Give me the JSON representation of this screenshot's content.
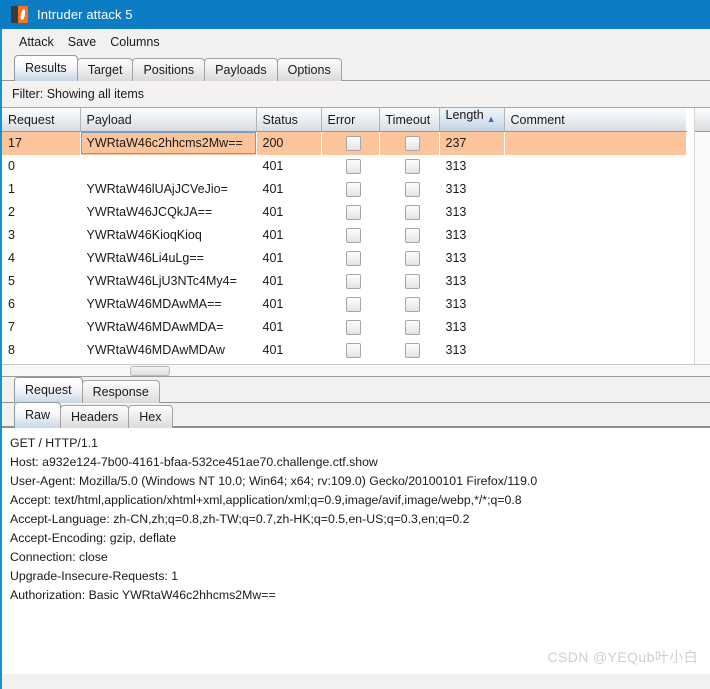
{
  "titlebar": {
    "title": "Intruder attack 5",
    "icon": "burp-suite-icon",
    "bg": "#0c7cc4"
  },
  "menubar": {
    "items": [
      {
        "label": "Attack"
      },
      {
        "label": "Save"
      },
      {
        "label": "Columns"
      }
    ]
  },
  "main_tabs": [
    {
      "label": "Results",
      "active": true
    },
    {
      "label": "Target",
      "active": false
    },
    {
      "label": "Positions",
      "active": false
    },
    {
      "label": "Payloads",
      "active": false
    },
    {
      "label": "Options",
      "active": false
    }
  ],
  "filter": {
    "label": "Filter: Showing all items"
  },
  "results_table": {
    "columns": [
      {
        "label": "Request",
        "sorted": false
      },
      {
        "label": "Payload",
        "sorted": false
      },
      {
        "label": "Status",
        "sorted": false
      },
      {
        "label": "Error",
        "sorted": false
      },
      {
        "label": "Timeout",
        "sorted": false
      },
      {
        "label": "Length",
        "sorted": true,
        "sort_arrow": "▲"
      },
      {
        "label": "Comment",
        "sorted": false
      }
    ],
    "rows": [
      {
        "request": "17",
        "payload": "YWRtaW46c2hhcms2Mw==",
        "status": "200",
        "error": false,
        "timeout": false,
        "length": "237",
        "comment": "",
        "selected": true
      },
      {
        "request": "0",
        "payload": "",
        "status": "401",
        "error": false,
        "timeout": false,
        "length": "313",
        "comment": "",
        "selected": false
      },
      {
        "request": "1",
        "payload": "YWRtaW46lUAjJCVeJio=",
        "status": "401",
        "error": false,
        "timeout": false,
        "length": "313",
        "comment": "",
        "selected": false
      },
      {
        "request": "2",
        "payload": "YWRtaW46JCQkJA==",
        "status": "401",
        "error": false,
        "timeout": false,
        "length": "313",
        "comment": "",
        "selected": false
      },
      {
        "request": "3",
        "payload": "YWRtaW46KioqKioq",
        "status": "401",
        "error": false,
        "timeout": false,
        "length": "313",
        "comment": "",
        "selected": false
      },
      {
        "request": "4",
        "payload": "YWRtaW46Li4uLg==",
        "status": "401",
        "error": false,
        "timeout": false,
        "length": "313",
        "comment": "",
        "selected": false
      },
      {
        "request": "5",
        "payload": "YWRtaW46LjU3NTc4My4=",
        "status": "401",
        "error": false,
        "timeout": false,
        "length": "313",
        "comment": "",
        "selected": false
      },
      {
        "request": "6",
        "payload": "YWRtaW46MDAwMA==",
        "status": "401",
        "error": false,
        "timeout": false,
        "length": "313",
        "comment": "",
        "selected": false
      },
      {
        "request": "7",
        "payload": "YWRtaW46MDAwMDA=",
        "status": "401",
        "error": false,
        "timeout": false,
        "length": "313",
        "comment": "",
        "selected": false
      },
      {
        "request": "8",
        "payload": "YWRtaW46MDAwMDAw",
        "status": "401",
        "error": false,
        "timeout": false,
        "length": "313",
        "comment": "",
        "selected": false
      }
    ],
    "selected_row_color": "#fbc49a"
  },
  "message_tabs": [
    {
      "label": "Request",
      "active": true
    },
    {
      "label": "Response",
      "active": false
    }
  ],
  "view_tabs": [
    {
      "label": "Raw",
      "active": true
    },
    {
      "label": "Headers",
      "active": false
    },
    {
      "label": "Hex",
      "active": false
    }
  ],
  "raw_request": {
    "lines": [
      "GET / HTTP/1.1",
      "Host: a932e124-7b00-4161-bfaa-532ce451ae70.challenge.ctf.show",
      "User-Agent: Mozilla/5.0 (Windows NT 10.0; Win64; x64; rv:109.0) Gecko/20100101 Firefox/119.0",
      "Accept: text/html,application/xhtml+xml,application/xml;q=0.9,image/avif,image/webp,*/*;q=0.8",
      "Accept-Language: zh-CN,zh;q=0.8,zh-TW;q=0.7,zh-HK;q=0.5,en-US;q=0.3,en;q=0.2",
      "Accept-Encoding: gzip, deflate",
      "Connection: close",
      "Upgrade-Insecure-Requests: 1",
      "Authorization: Basic YWRtaW46c2hhcms2Mw=="
    ]
  },
  "watermark": {
    "text": "CSDN @YEQub叶小白"
  }
}
